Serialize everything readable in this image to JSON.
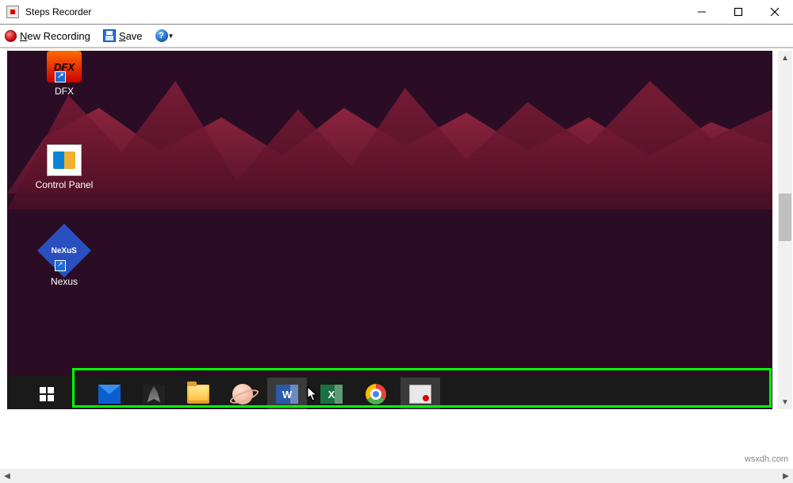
{
  "window": {
    "title": "Steps Recorder"
  },
  "toolbar": {
    "new_recording": "New Recording",
    "new_recording_accel": "N",
    "save": "Save",
    "save_accel": "S",
    "help": "?"
  },
  "desktop_icons": {
    "dfx": {
      "label": "DFX",
      "badge": "DFX"
    },
    "control_panel": {
      "label": "Control Panel"
    },
    "nexus": {
      "label": "Nexus",
      "badge": "NeXuS"
    }
  },
  "taskbar": {
    "items": [
      {
        "name": "mail",
        "label": "Mail"
      },
      {
        "name": "predator",
        "label": "Predator"
      },
      {
        "name": "file-explorer",
        "label": "File Explorer"
      },
      {
        "name": "saturn",
        "label": "App"
      },
      {
        "name": "word",
        "label": "W",
        "active": true
      },
      {
        "name": "excel",
        "label": "X"
      },
      {
        "name": "chrome",
        "label": "Chrome"
      },
      {
        "name": "steps-recorder",
        "label": "Steps Recorder",
        "active": true
      }
    ]
  },
  "watermark": "wsxdh.com"
}
